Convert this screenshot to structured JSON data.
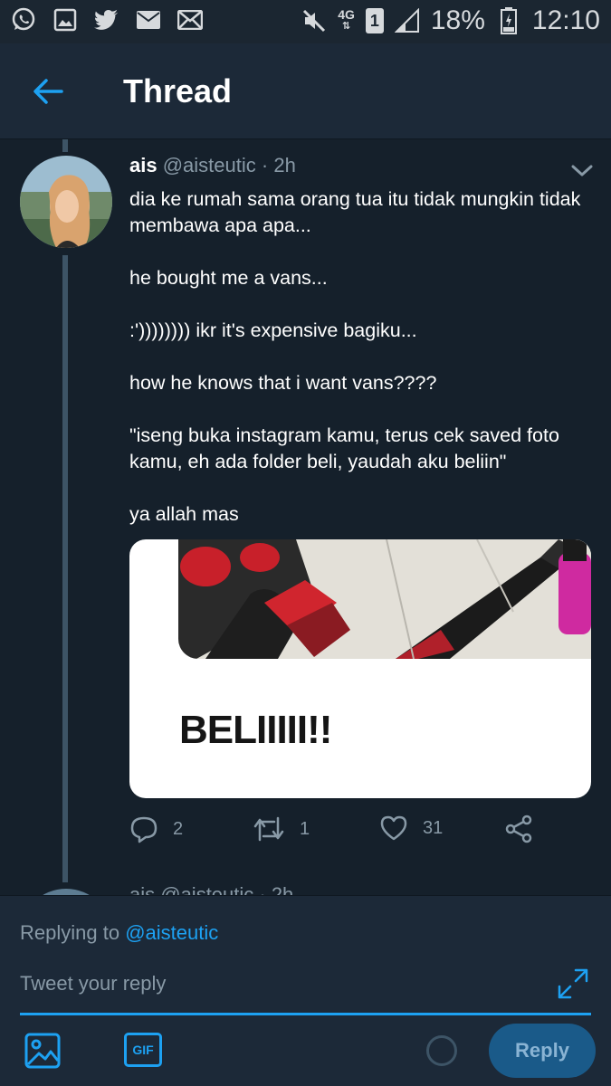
{
  "status_bar": {
    "left_icons": [
      "whatsapp-icon",
      "gallery-icon",
      "twitter-icon",
      "mail-icon",
      "email-icon"
    ],
    "network": "4G",
    "sim": "1",
    "battery": "18%",
    "time": "12:10"
  },
  "header": {
    "title": "Thread"
  },
  "tweet": {
    "name": "ais",
    "handle": "@aisteutic",
    "time": "· 2h",
    "paragraphs": [
      "dia ke rumah sama orang tua itu tidak mungkin tidak membawa apa apa...",
      "he bought me a vans...",
      ":')))))))) ikr it's expensive bagiku...",
      "how he knows that i want vans????",
      "\"iseng buka instagram kamu, terus cek saved foto kamu, eh ada folder beli, yaudah aku beliin\"",
      "ya allah mas"
    ],
    "media_text": "BELIIIII!!",
    "replies": "2",
    "retweets": "1",
    "likes": "31"
  },
  "next_tweet": {
    "partial_header": "ais @aisteutic · 2h"
  },
  "composer": {
    "replying_prefix": "Replying to",
    "replying_to": "@aisteutic",
    "placeholder": "Tweet your reply",
    "gif_label": "GIF",
    "reply_label": "Reply"
  },
  "colors": {
    "background": "#15202b",
    "header": "#1c2938",
    "accent": "#1da1f2",
    "muted": "#8899a6",
    "thread_line": "#3d5466"
  }
}
